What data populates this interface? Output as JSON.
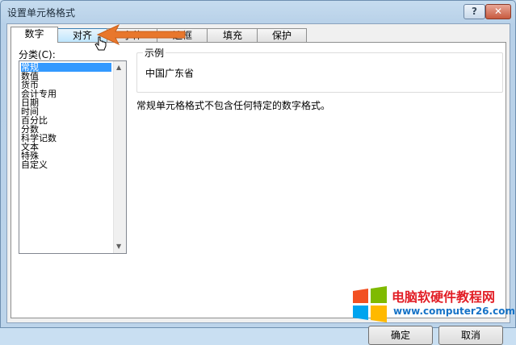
{
  "window": {
    "title": "设置单元格格式"
  },
  "titlebar_buttons": {
    "help": "?",
    "close": "✕"
  },
  "tabs": [
    {
      "label": "数字"
    },
    {
      "label": "对齐"
    },
    {
      "label": "字体"
    },
    {
      "label": "边框"
    },
    {
      "label": "填充"
    },
    {
      "label": "保护"
    }
  ],
  "category": {
    "label": "分类(C):",
    "items": [
      "常规",
      "数值",
      "货币",
      "会计专用",
      "日期",
      "时间",
      "百分比",
      "分数",
      "科学记数",
      "文本",
      "特殊",
      "自定义"
    ],
    "selected": "常规"
  },
  "sample": {
    "legend": "示例",
    "value": "中国广东省"
  },
  "description": "常规单元格格式不包含任何特定的数字格式。",
  "buttons": {
    "ok": "确定",
    "cancel": "取消"
  },
  "watermark": {
    "title": "电脑软硬件教程网",
    "url": "www.computer26.com"
  },
  "colors": {
    "arrow": "#e8772c",
    "selection": "#3399ff",
    "watermark_title": "#e21e26",
    "watermark_url": "#1673c7"
  }
}
